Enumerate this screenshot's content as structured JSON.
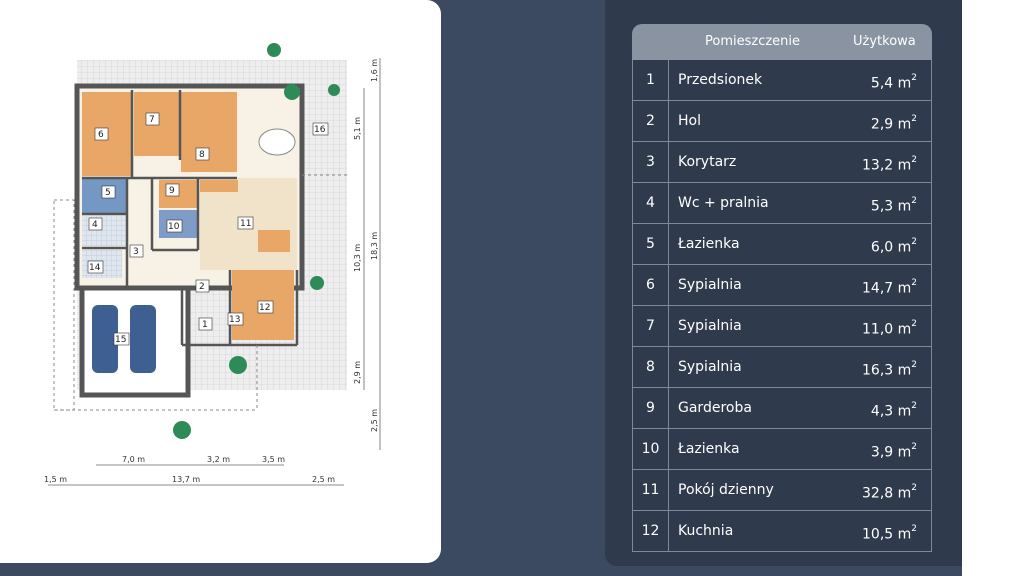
{
  "table": {
    "header": {
      "room": "Pomieszczenie",
      "area": "Użytkowa"
    },
    "rows": [
      {
        "num": "1",
        "name": "Przedsionek",
        "area": "5,4 m",
        "unit_sup": "2"
      },
      {
        "num": "2",
        "name": "Hol",
        "area": "2,9 m",
        "unit_sup": "2"
      },
      {
        "num": "3",
        "name": "Korytarz",
        "area": "13,2 m",
        "unit_sup": "2"
      },
      {
        "num": "4",
        "name": "Wc + pralnia",
        "area": "5,3 m",
        "unit_sup": "2"
      },
      {
        "num": "5",
        "name": "Łazienka",
        "area": "6,0 m",
        "unit_sup": "2"
      },
      {
        "num": "6",
        "name": "Sypialnia",
        "area": "14,7 m",
        "unit_sup": "2"
      },
      {
        "num": "7",
        "name": "Sypialnia",
        "area": "11,0 m",
        "unit_sup": "2"
      },
      {
        "num": "8",
        "name": "Sypialnia",
        "area": "16,3 m",
        "unit_sup": "2"
      },
      {
        "num": "9",
        "name": "Garderoba",
        "area": "4,3 m",
        "unit_sup": "2"
      },
      {
        "num": "10",
        "name": "Łazienka",
        "area": "3,9 m",
        "unit_sup": "2"
      },
      {
        "num": "11",
        "name": "Pokój dzienny",
        "area": "32,8 m",
        "unit_sup": "2"
      },
      {
        "num": "12",
        "name": "Kuchnia",
        "area": "10,5 m",
        "unit_sup": "2"
      }
    ]
  },
  "plan": {
    "room_labels": [
      "1",
      "2",
      "3",
      "4",
      "5",
      "6",
      "7",
      "8",
      "9",
      "10",
      "11",
      "12",
      "13",
      "14",
      "15",
      "16"
    ],
    "dims_bottom": {
      "d1": "7,0 m",
      "d2": "3,2 m",
      "d3": "3,5 m",
      "d4": "1,5 m",
      "d5": "13,7 m",
      "d6": "2,5 m"
    },
    "dims_right": {
      "r1": "1,6 m",
      "r2": "5,1 m",
      "r3": "10,3 m",
      "r4": "18,3 m",
      "r5": "2,9 m",
      "r6": "2,5 m"
    }
  },
  "colors": {
    "background": "#3b4a60",
    "panel": "#2f3a4d",
    "header": "#8a93a2",
    "grid": "#7e8898",
    "wood": "#e8a766",
    "tile": "#4a78b8"
  }
}
